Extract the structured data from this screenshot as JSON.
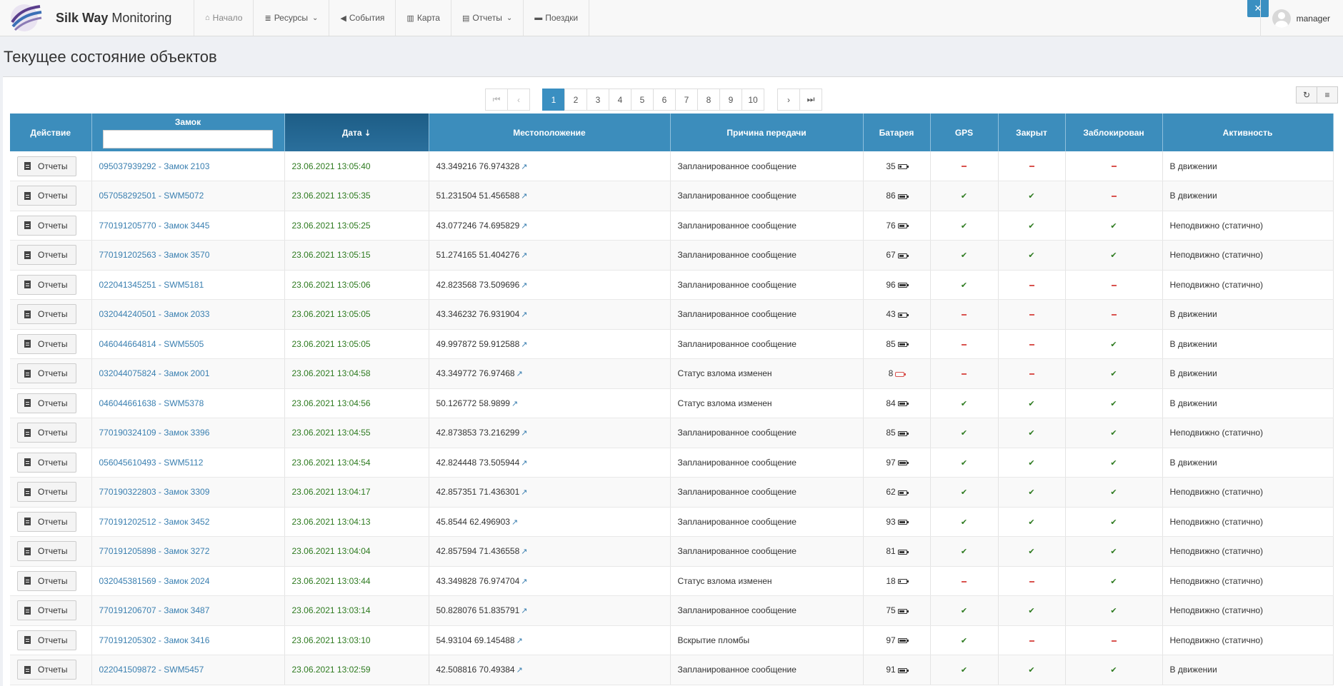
{
  "nav": {
    "brand_bold": "Silk Way",
    "brand_rest": " Monitoring",
    "items": [
      {
        "label": "Начало",
        "icon": "home-icon"
      },
      {
        "label": "Ресурсы",
        "icon": "database-icon"
      },
      {
        "label": "События",
        "icon": "bullhorn-icon"
      },
      {
        "label": "Карта",
        "icon": "map-icon"
      },
      {
        "label": "Отчеты",
        "icon": "file-icon"
      },
      {
        "label": "Поездки",
        "icon": "truck-icon"
      }
    ],
    "user": "manager",
    "mute_icon": "mute-icon"
  },
  "page_title": "Текущее состояние объектов",
  "pagination": {
    "pages": [
      "1",
      "2",
      "3",
      "4",
      "5",
      "6",
      "7",
      "8",
      "9",
      "10"
    ],
    "active": "1"
  },
  "toolbar": {
    "refresh_icon": "refresh-icon",
    "columns_icon": "list-icon"
  },
  "columns": {
    "action": "Действие",
    "lock": "Замок",
    "date": "Дата",
    "location": "Местоположение",
    "reason": "Причина передачи",
    "battery": "Батарея",
    "gps": "GPS",
    "closed": "Закрыт",
    "blocked": "Заблокирован",
    "activity": "Активность"
  },
  "reports_label": "Отчеты",
  "colors": {
    "accent": "#3c8dbc",
    "date": "#2d7a1f",
    "link": "#3a7fb0",
    "false_mark": "#d9534f"
  },
  "rows": [
    {
      "lock": "095037939292 - Замок 2103",
      "date": "23.06.2021 13:05:40",
      "loc": "43.349216 76.974328",
      "reason": "Запланированное сообщение",
      "battery": 35,
      "gps": false,
      "closed": false,
      "blocked": false,
      "activity": "В движении"
    },
    {
      "lock": "057058292501 - SWM5072",
      "date": "23.06.2021 13:05:35",
      "loc": "51.231504 51.456588",
      "reason": "Запланированное сообщение",
      "battery": 86,
      "gps": true,
      "closed": true,
      "blocked": false,
      "activity": "В движении"
    },
    {
      "lock": "770191205770 - Замок 3445",
      "date": "23.06.2021 13:05:25",
      "loc": "43.077246 74.695829",
      "reason": "Запланированное сообщение",
      "battery": 76,
      "gps": true,
      "closed": true,
      "blocked": true,
      "activity": "Неподвижно (статично)"
    },
    {
      "lock": "770191202563 - Замок 3570",
      "date": "23.06.2021 13:05:15",
      "loc": "51.274165 51.404276",
      "reason": "Запланированное сообщение",
      "battery": 67,
      "gps": true,
      "closed": true,
      "blocked": true,
      "activity": "Неподвижно (статично)"
    },
    {
      "lock": "022041345251 - SWM5181",
      "date": "23.06.2021 13:05:06",
      "loc": "42.823568 73.509696",
      "reason": "Запланированное сообщение",
      "battery": 96,
      "gps": true,
      "closed": false,
      "blocked": false,
      "activity": "Неподвижно (статично)"
    },
    {
      "lock": "032044240501 - Замок 2033",
      "date": "23.06.2021 13:05:05",
      "loc": "43.346232 76.931904",
      "reason": "Запланированное сообщение",
      "battery": 43,
      "gps": false,
      "closed": false,
      "blocked": false,
      "activity": "В движении"
    },
    {
      "lock": "046044664814 - SWM5505",
      "date": "23.06.2021 13:05:05",
      "loc": "49.997872 59.912588",
      "reason": "Запланированное сообщение",
      "battery": 85,
      "gps": false,
      "closed": false,
      "blocked": true,
      "activity": "В движении"
    },
    {
      "lock": "032044075824 - Замок 2001",
      "date": "23.06.2021 13:04:58",
      "loc": "43.349772 76.97468",
      "reason": "Статус взлома изменен",
      "battery": 8,
      "gps": false,
      "closed": false,
      "blocked": true,
      "activity": "В движении"
    },
    {
      "lock": "046044661638 - SWM5378",
      "date": "23.06.2021 13:04:56",
      "loc": "50.126772 58.9899",
      "reason": "Статус взлома изменен",
      "battery": 84,
      "gps": true,
      "closed": true,
      "blocked": true,
      "activity": "В движении"
    },
    {
      "lock": "770190324109 - Замок 3396",
      "date": "23.06.2021 13:04:55",
      "loc": "42.873853 73.216299",
      "reason": "Запланированное сообщение",
      "battery": 85,
      "gps": true,
      "closed": true,
      "blocked": true,
      "activity": "Неподвижно (статично)"
    },
    {
      "lock": "056045610493 - SWM5112",
      "date": "23.06.2021 13:04:54",
      "loc": "42.824448 73.505944",
      "reason": "Запланированное сообщение",
      "battery": 97,
      "gps": true,
      "closed": true,
      "blocked": true,
      "activity": "В движении"
    },
    {
      "lock": "770190322803 - Замок 3309",
      "date": "23.06.2021 13:04:17",
      "loc": "42.857351 71.436301",
      "reason": "Запланированное сообщение",
      "battery": 62,
      "gps": true,
      "closed": true,
      "blocked": true,
      "activity": "Неподвижно (статично)"
    },
    {
      "lock": "770191202512 - Замок 3452",
      "date": "23.06.2021 13:04:13",
      "loc": "45.8544 62.496903",
      "reason": "Запланированное сообщение",
      "battery": 93,
      "gps": true,
      "closed": true,
      "blocked": true,
      "activity": "Неподвижно (статично)"
    },
    {
      "lock": "770191205898 - Замок 3272",
      "date": "23.06.2021 13:04:04",
      "loc": "42.857594 71.436558",
      "reason": "Запланированное сообщение",
      "battery": 81,
      "gps": true,
      "closed": true,
      "blocked": true,
      "activity": "Неподвижно (статично)"
    },
    {
      "lock": "032045381569 - Замок 2024",
      "date": "23.06.2021 13:03:44",
      "loc": "43.349828 76.974704",
      "reason": "Статус взлома изменен",
      "battery": 18,
      "gps": false,
      "closed": false,
      "blocked": true,
      "activity": "Неподвижно (статично)"
    },
    {
      "lock": "770191206707 - Замок 3487",
      "date": "23.06.2021 13:03:14",
      "loc": "50.828076 51.835791",
      "reason": "Запланированное сообщение",
      "battery": 75,
      "gps": true,
      "closed": true,
      "blocked": true,
      "activity": "Неподвижно (статично)"
    },
    {
      "lock": "770191205302 - Замок 3416",
      "date": "23.06.2021 13:03:10",
      "loc": "54.93104 69.145488",
      "reason": "Вскрытие пломбы",
      "battery": 97,
      "gps": true,
      "closed": false,
      "blocked": false,
      "activity": "Неподвижно (статично)"
    },
    {
      "lock": "022041509872 - SWM5457",
      "date": "23.06.2021 13:02:59",
      "loc": "42.508816 70.49384",
      "reason": "Запланированное сообщение",
      "battery": 91,
      "gps": true,
      "closed": true,
      "blocked": true,
      "activity": "В движении"
    }
  ]
}
